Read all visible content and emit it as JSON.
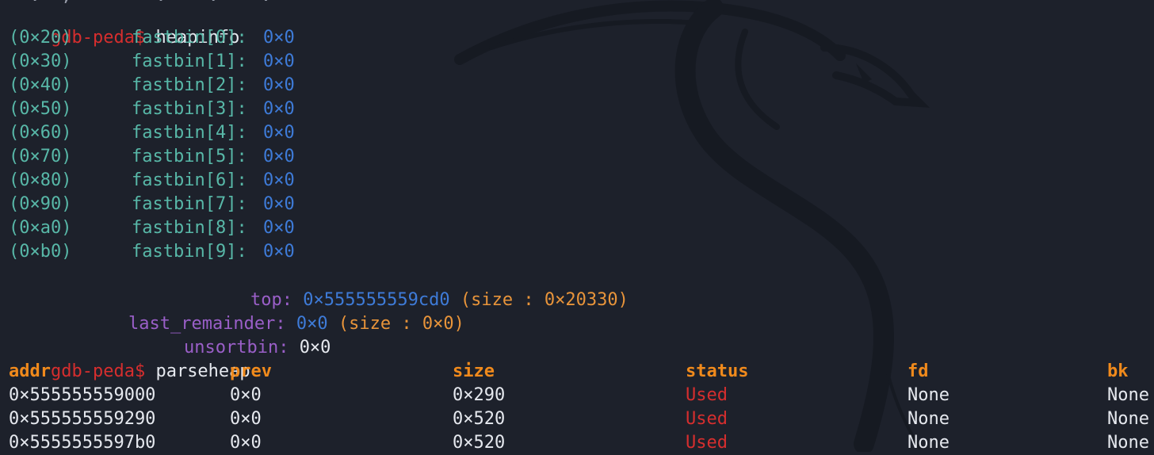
{
  "prompt": {
    "name": "gdb-peda",
    "symbol": "$"
  },
  "commands": {
    "first": "heapinfo",
    "second": "parseheap"
  },
  "fastbins": [
    {
      "size": "(0×20)",
      "label": "fastbin[0]:",
      "value": "0×0"
    },
    {
      "size": "(0×30)",
      "label": "fastbin[1]:",
      "value": "0×0"
    },
    {
      "size": "(0×40)",
      "label": "fastbin[2]:",
      "value": "0×0"
    },
    {
      "size": "(0×50)",
      "label": "fastbin[3]:",
      "value": "0×0"
    },
    {
      "size": "(0×60)",
      "label": "fastbin[4]:",
      "value": "0×0"
    },
    {
      "size": "(0×70)",
      "label": "fastbin[5]:",
      "value": "0×0"
    },
    {
      "size": "(0×80)",
      "label": "fastbin[6]:",
      "value": "0×0"
    },
    {
      "size": "(0×90)",
      "label": "fastbin[7]:",
      "value": "0×0"
    },
    {
      "size": "(0×a0)",
      "label": "fastbin[8]:",
      "value": "0×0"
    },
    {
      "size": "(0×b0)",
      "label": "fastbin[9]:",
      "value": "0×0"
    }
  ],
  "top": {
    "label": "top:",
    "addr": "0×555555559cd0",
    "size": "(size : 0×20330)"
  },
  "last_remainder": {
    "label": "last_remainder:",
    "addr": "0×0",
    "size": "(size : 0×0)"
  },
  "unsortbin": {
    "label": "unsortbin:",
    "addr": "0×0"
  },
  "table": {
    "headers": [
      "addr",
      "prev",
      "size",
      "status",
      "fd",
      "bk"
    ],
    "rows": [
      [
        "0×555555559000",
        "0×0",
        "0×290",
        "Used",
        "None",
        "None"
      ],
      [
        "0×555555559290",
        "0×0",
        "0×520",
        "Used",
        "None",
        "None"
      ],
      [
        "0×5555555597b0",
        "0×0",
        "0×520",
        "Used",
        "None",
        "None"
      ]
    ]
  },
  "colors": {
    "background": "#1d212b",
    "prompt": "#d62e2e",
    "bin_label": "#58b8a8",
    "address": "#3e7bd8",
    "special_label": "#9a5fc8",
    "size_info": "#e8943a",
    "table_header": "#f08a1c",
    "status_used": "#d62e2e",
    "default_text": "#e6e9ef"
  },
  "background_logo": "kali-dragon-icon"
}
